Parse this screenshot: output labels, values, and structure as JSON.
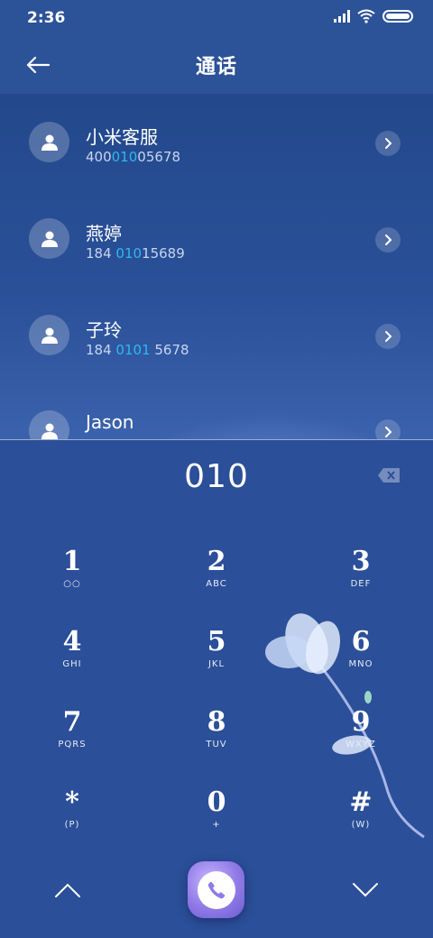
{
  "status_bar": {
    "time": "2:36"
  },
  "header": {
    "title": "通话"
  },
  "contacts": [
    {
      "name": "小米客服",
      "number_pre": "400",
      "number_match": "010",
      "number_post": "05678"
    },
    {
      "name": "燕婷",
      "number_pre": "184 ",
      "number_match": "010",
      "number_post": "15689"
    },
    {
      "name": "子玲",
      "number_pre": "184 ",
      "number_match": "0101",
      "number_post": " 5678"
    },
    {
      "name": "Jason",
      "number_pre": "",
      "number_match": "",
      "number_post": ""
    }
  ],
  "dialer": {
    "input": "010",
    "keys": [
      {
        "digit": "1",
        "letters": "○○"
      },
      {
        "digit": "2",
        "letters": "ABC"
      },
      {
        "digit": "3",
        "letters": "DEF"
      },
      {
        "digit": "4",
        "letters": "GHI"
      },
      {
        "digit": "5",
        "letters": "JKL"
      },
      {
        "digit": "6",
        "letters": "MNO"
      },
      {
        "digit": "7",
        "letters": "PQRS"
      },
      {
        "digit": "8",
        "letters": "TUV"
      },
      {
        "digit": "9",
        "letters": "WXYZ"
      },
      {
        "digit": "*",
        "letters": "(P)"
      },
      {
        "digit": "0",
        "letters": "+"
      },
      {
        "digit": "#",
        "letters": "(W)"
      }
    ]
  },
  "colors": {
    "background": "#2b4f98",
    "match_highlight": "#2fb8f0",
    "call_button": "#8f7ae6"
  },
  "icons": {
    "back": "arrow-left-icon",
    "avatar": "person-icon",
    "chevron": "chevron-right-icon",
    "delete": "backspace-icon",
    "collapse": "chevron-up-icon",
    "expand": "chevron-down-icon",
    "call": "phone-icon"
  }
}
